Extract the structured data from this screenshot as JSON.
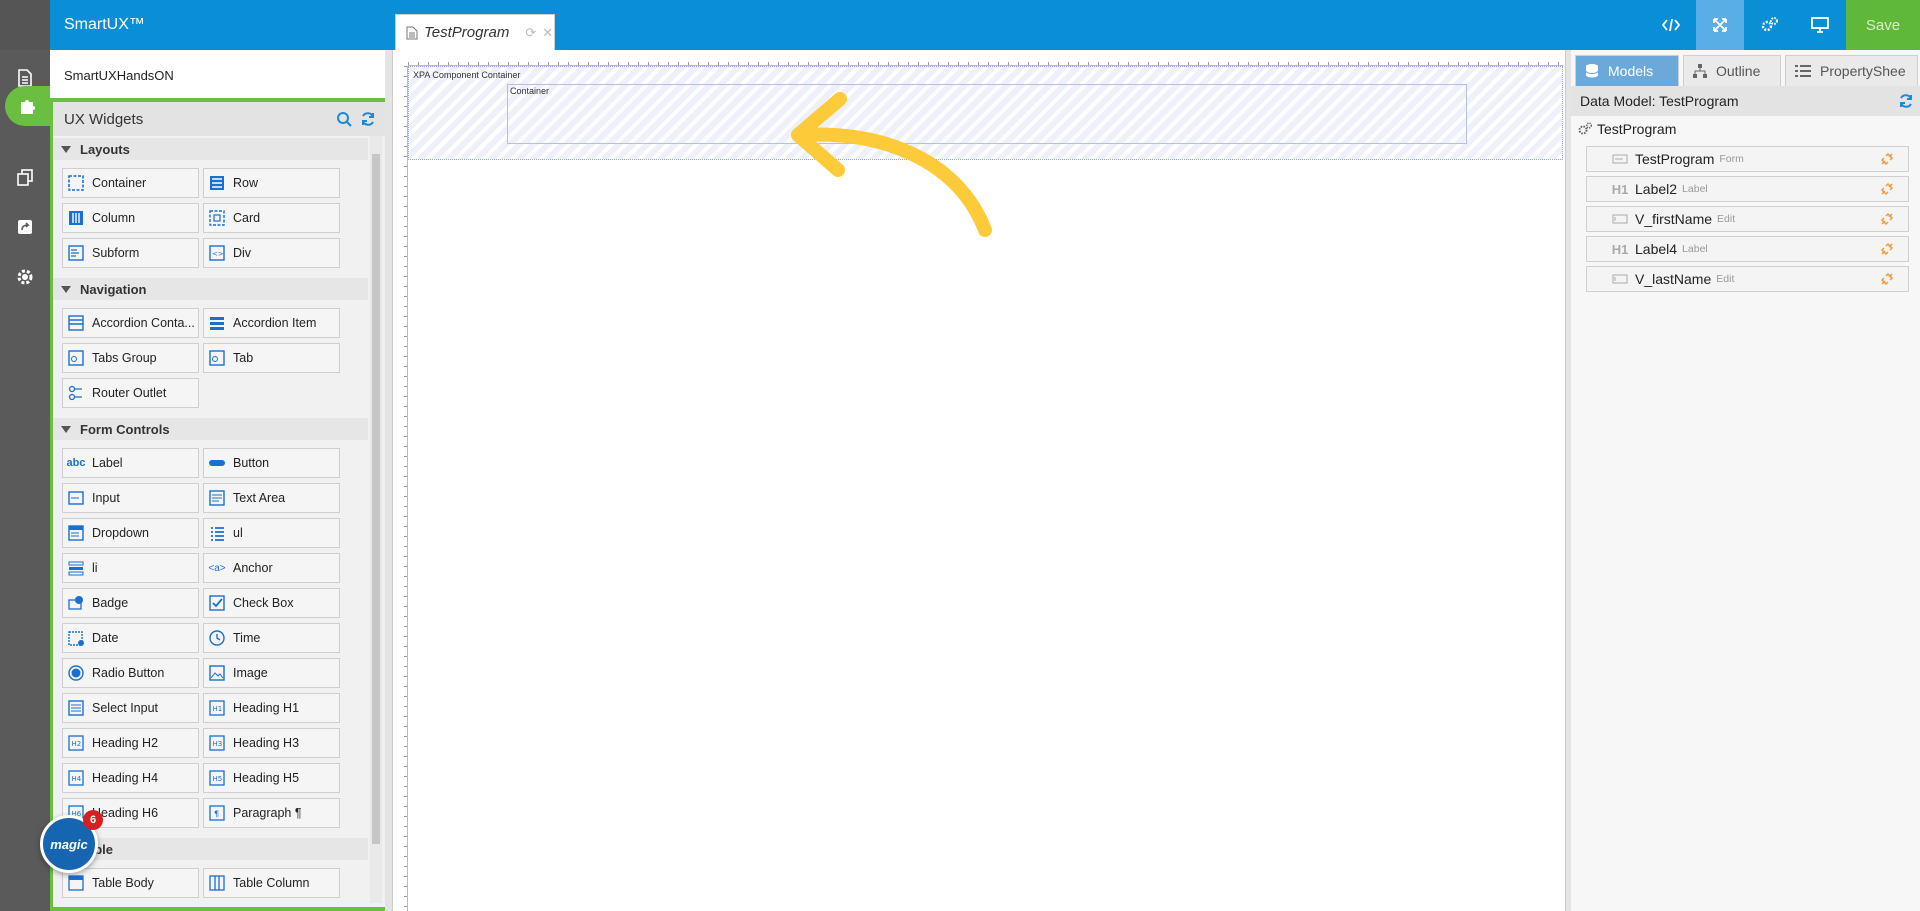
{
  "app": {
    "brand": "SmartUX™",
    "project": "SmartUXHandsON"
  },
  "doc_tab": {
    "title": "TestProgram"
  },
  "toolbar": {
    "save_label": "Save"
  },
  "widgets_panel": {
    "title": "UX Widgets",
    "sections": [
      {
        "name": "Layouts",
        "items": [
          "Container",
          "Row",
          "Column",
          "Card",
          "Subform",
          "Div"
        ]
      },
      {
        "name": "Navigation",
        "items": [
          "Accordion Conta...",
          "Accordion Item",
          "Tabs Group",
          "Tab",
          "Router Outlet"
        ]
      },
      {
        "name": "Form Controls",
        "items": [
          "Label",
          "Button",
          "Input",
          "Text Area",
          "Dropdown",
          "ul",
          "li",
          "Anchor",
          "Badge",
          "Check Box",
          "Date",
          "Time",
          "Radio Button",
          "Image",
          "Select Input",
          "Heading H1",
          "Heading H2",
          "Heading H3",
          "Heading H4",
          "Heading H5",
          "Heading H6",
          "Paragraph ¶"
        ]
      },
      {
        "name": "Table",
        "items": [
          "Table Body",
          "Table Column"
        ]
      }
    ]
  },
  "magic_badge": {
    "logo": "magic",
    "count": "6"
  },
  "canvas": {
    "outer_caption": "XPA Component Container",
    "inner_caption": "Container"
  },
  "right_panel": {
    "tabs": [
      "Models",
      "Outline",
      "PropertyShee"
    ],
    "header": "Data Model: TestProgram",
    "root": "TestProgram",
    "nodes": [
      {
        "name": "TestProgram",
        "type": "Form"
      },
      {
        "name": "Label2",
        "type": "Label"
      },
      {
        "name": "V_firstName",
        "type": "Edit"
      },
      {
        "name": "Label4",
        "type": "Label"
      },
      {
        "name": "V_lastName",
        "type": "Edit"
      }
    ]
  },
  "colors": {
    "topbar": "#0a8fd6",
    "accent_green": "#6abf40",
    "annotation_arrow": "#fdca3a"
  }
}
